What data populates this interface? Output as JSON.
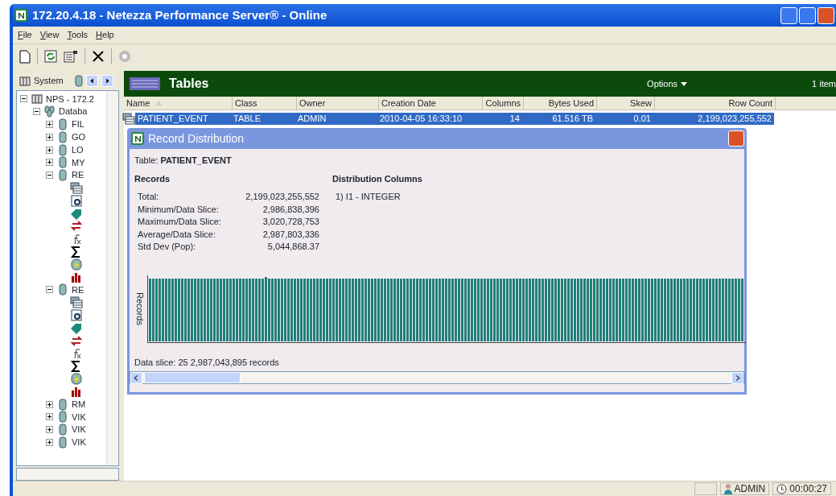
{
  "window": {
    "title": "172.20.4.18  - Netezza Performance Server® - Online"
  },
  "menu": [
    "File",
    "View",
    "Tools",
    "Help"
  ],
  "sidebar": {
    "tab": "System",
    "tree": [
      {
        "label": "NPS - 172.2",
        "kind": "server",
        "expanded": true,
        "children": [
          {
            "label": "Databa",
            "kind": "databases",
            "expanded": true,
            "children": [
              {
                "label": "FIL",
                "kind": "database",
                "expanded": false
              },
              {
                "label": "GO",
                "kind": "database",
                "expanded": false
              },
              {
                "label": "LO",
                "kind": "database",
                "expanded": false
              },
              {
                "label": "MY",
                "kind": "database",
                "expanded": false
              },
              {
                "label": "RE",
                "kind": "database",
                "expanded": true,
                "children": [
                  {
                    "kind": "tables"
                  },
                  {
                    "kind": "views"
                  },
                  {
                    "kind": "sequences"
                  },
                  {
                    "kind": "synonyms"
                  },
                  {
                    "kind": "functions"
                  },
                  {
                    "kind": "aggregates"
                  },
                  {
                    "kind": "procedures"
                  },
                  {
                    "kind": "statistics"
                  }
                ]
              },
              {
                "label": "RE",
                "kind": "database",
                "expanded": true,
                "children": [
                  {
                    "kind": "tables"
                  },
                  {
                    "kind": "views"
                  },
                  {
                    "kind": "sequences"
                  },
                  {
                    "kind": "synonyms"
                  },
                  {
                    "kind": "functions"
                  },
                  {
                    "kind": "aggregates"
                  },
                  {
                    "kind": "procedures"
                  },
                  {
                    "kind": "statistics"
                  }
                ]
              },
              {
                "label": "RM",
                "kind": "database",
                "expanded": false
              },
              {
                "label": "VIK",
                "kind": "database",
                "expanded": false
              },
              {
                "label": "VIK",
                "kind": "database",
                "expanded": false
              },
              {
                "label": "VIK",
                "kind": "database",
                "expanded": false
              }
            ]
          }
        ]
      }
    ]
  },
  "panel": {
    "title": "Tables",
    "options": "Options",
    "count": "1 item"
  },
  "table": {
    "columns": [
      {
        "label": "Name",
        "kind": "text",
        "sorted": true
      },
      {
        "label": "Class",
        "kind": "text",
        "sorted": false
      },
      {
        "label": "Owner",
        "kind": "text",
        "sorted": false
      },
      {
        "label": "Creation Date",
        "kind": "text",
        "sorted": false
      },
      {
        "label": "Columns",
        "kind": "number",
        "sorted": false
      },
      {
        "label": "Bytes Used",
        "kind": "number",
        "sorted": false
      },
      {
        "label": "Skew",
        "kind": "number",
        "sorted": false
      },
      {
        "label": "Row Count",
        "kind": "number",
        "sorted": false
      }
    ],
    "rows": [
      {
        "selected": true,
        "cells": [
          "PATIENT_EVENT",
          "TABLE",
          "ADMIN",
          "2010-04-05 16:33:10",
          "14",
          "61.516 TB",
          "0.01",
          "2,199,023,255,552"
        ]
      }
    ]
  },
  "dialog": {
    "title": "Record Distribution",
    "table_label": "Table: **PATIENT_EVENT**",
    "records_heading": "Records",
    "stats": [
      {
        "label": "Total:",
        "value": "2,199,023,255,552"
      },
      {
        "label": "Minimum/Data Slice:",
        "value": "2,986,838,396"
      },
      {
        "label": "Maximum/Data Slice:",
        "value": "3,020,728,753"
      },
      {
        "label": "Average/Data Slice:",
        "value": "2,987,803,336"
      },
      {
        "label": "Std Dev (Pop):",
        "value": "5,044,868.37"
      }
    ],
    "distribution_heading": "Distribution Columns",
    "distribution": [
      "1) I1  - INTEGER"
    ],
    "chart": {
      "ylabel": "Records"
    },
    "footer": "Data slice: 25   2,987,043,895 records"
  },
  "status_bar": {
    "user": "ADMIN",
    "time": "00:00:27"
  }
}
